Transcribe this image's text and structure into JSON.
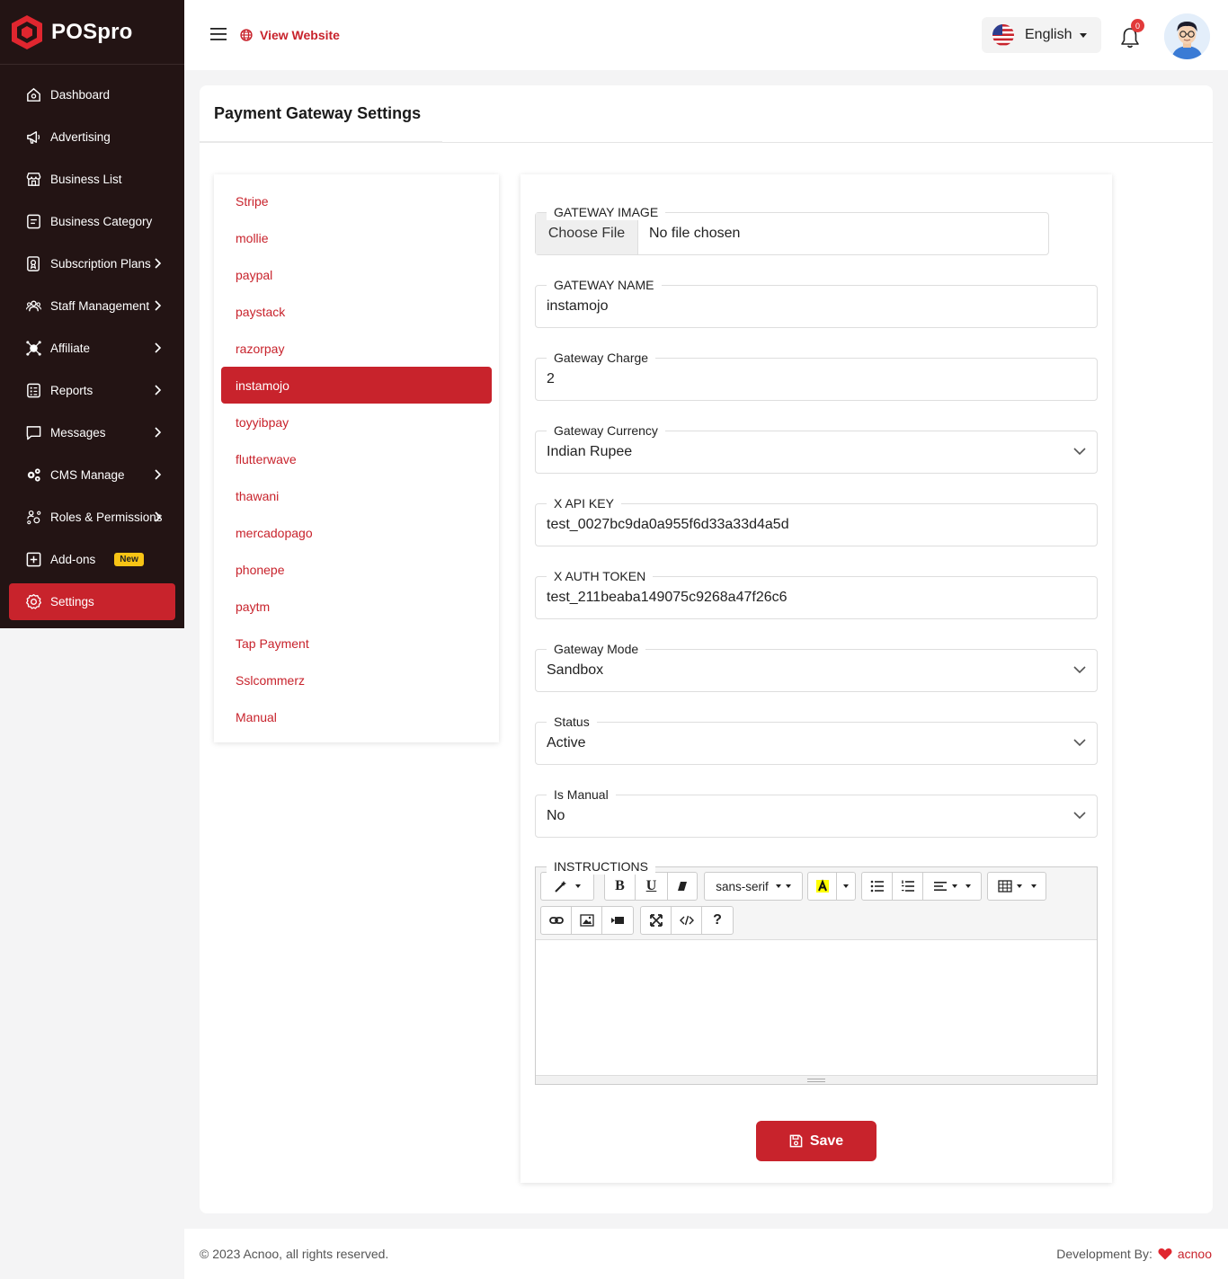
{
  "app": {
    "name": "POSpro"
  },
  "sidebar": {
    "items": [
      {
        "label": "Dashboard",
        "icon": "home-icon",
        "has_chevron": false
      },
      {
        "label": "Advertising",
        "icon": "megaphone-icon",
        "has_chevron": false
      },
      {
        "label": "Business List",
        "icon": "store-icon",
        "has_chevron": false
      },
      {
        "label": "Business Category",
        "icon": "list-icon",
        "has_chevron": false
      },
      {
        "label": "Subscription Plans",
        "icon": "plans-icon",
        "has_chevron": true
      },
      {
        "label": "Staff Management",
        "icon": "staff-icon",
        "has_chevron": true
      },
      {
        "label": "Affiliate",
        "icon": "affiliate-icon",
        "has_chevron": true
      },
      {
        "label": "Reports",
        "icon": "reports-icon",
        "has_chevron": true
      },
      {
        "label": "Messages",
        "icon": "message-icon",
        "has_chevron": true
      },
      {
        "label": "CMS Manage",
        "icon": "cog-icon",
        "has_chevron": true
      },
      {
        "label": "Roles & Permissions",
        "icon": "roles-icon",
        "has_chevron": true
      },
      {
        "label": "Add-ons",
        "icon": "plus-square-icon",
        "has_chevron": false,
        "badge": "New"
      },
      {
        "label": "Settings",
        "icon": "settings-icon",
        "has_chevron": false,
        "active": true
      }
    ]
  },
  "header": {
    "view_website": "View Website",
    "language": "English",
    "notification_count": "0"
  },
  "page": {
    "title": "Payment Gateway Settings"
  },
  "gateways": {
    "items": [
      "Stripe",
      "mollie",
      "paypal",
      "paystack",
      "razorpay",
      "instamojo",
      "toyyibpay",
      "flutterwave",
      "thawani",
      "mercadopago",
      "phonepe",
      "paytm",
      "Tap Payment",
      "Sslcommerz",
      "Manual"
    ],
    "active": "instamojo"
  },
  "form": {
    "gateway_image": {
      "label": "GATEWAY IMAGE",
      "button": "Choose File",
      "file_name": "No file chosen"
    },
    "gateway_name": {
      "label": "GATEWAY NAME",
      "value": "instamojo"
    },
    "gateway_charge": {
      "label": "Gateway Charge",
      "value": "2"
    },
    "gateway_currency": {
      "label": "Gateway Currency",
      "value": "Indian Rupee"
    },
    "x_api_key": {
      "label": "X API KEY",
      "value": "test_0027bc9da0a955f6d33a33d4a5d"
    },
    "x_auth_token": {
      "label": "X AUTH TOKEN",
      "value": "test_211beaba149075c9268a47f26c6"
    },
    "gateway_mode": {
      "label": "Gateway Mode",
      "value": "Sandbox"
    },
    "status": {
      "label": "Status",
      "value": "Active"
    },
    "is_manual": {
      "label": "Is Manual",
      "value": "No"
    },
    "instructions": {
      "label": "INSTRUCTIONS",
      "font_name": "sans-serif",
      "bold": "B",
      "underline": "U",
      "help": "?"
    },
    "save": "Save"
  },
  "footer": {
    "copyright": "© 2023 Acnoo, all rights reserved.",
    "dev_label": "Development By:",
    "dev_brand": "acnoo"
  },
  "colors": {
    "primary": "#c8232c",
    "sidebar_bg": "#231414",
    "badge": "#f7c415"
  }
}
